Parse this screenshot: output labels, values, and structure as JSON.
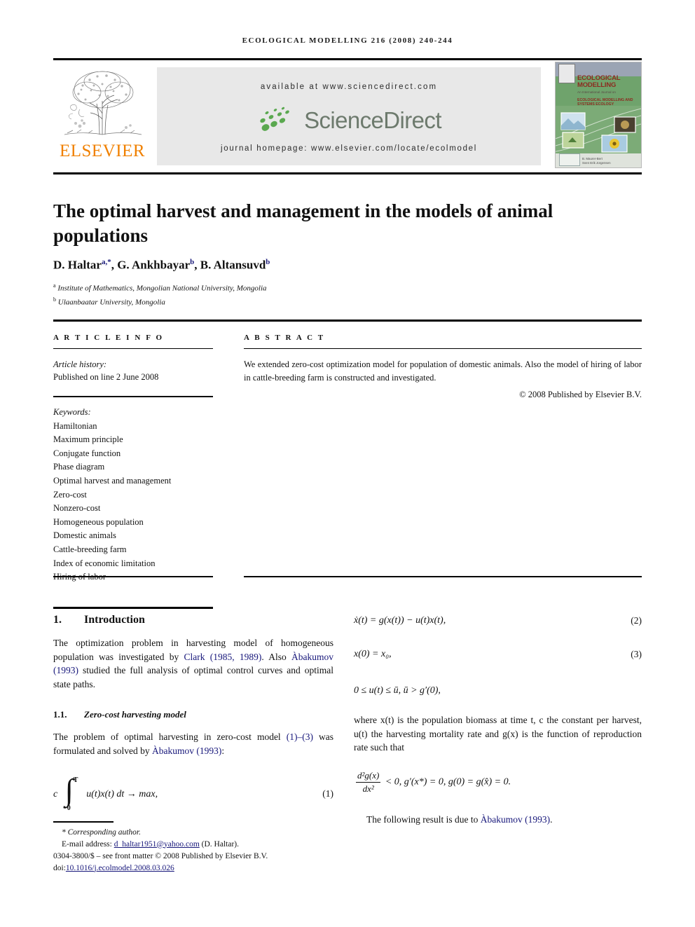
{
  "runhead": "ECOLOGICAL MODELLING 216 (2008) 240-244",
  "masthead": {
    "publisher_name": "ELSEVIER",
    "available_at": "available at www.sciencedirect.com",
    "sciencedirect_wordmark": "ScienceDirect",
    "journal_homepage": "journal homepage: www.elsevier.com/locate/ecolmodel",
    "cover": {
      "title_line1": "ECOLOGICAL",
      "title_line2": "MODELLING",
      "subtitle": "An International Journal on",
      "subtitle2_line1": "ECOLOGICAL MODELLING AND",
      "subtitle2_line2": "SYSTEMS ECOLOGY",
      "editor_line1": "B. Maurer-Bert",
      "editor_line2": "Sven Erik Jorgensen"
    }
  },
  "article": {
    "title": "The optimal harvest and management in the models of animal populations",
    "authors_html": "D. Haltar<sup>a,*</sup>, G. Ankhbayar<sup>b</sup>, B. Altansuvd<sup>b</sup>",
    "affiliation_a": "Institute of Mathematics, Mongolian National University, Mongolia",
    "affiliation_b": "Ulaanbaatar University, Mongolia"
  },
  "info": {
    "heading": "A R T I C L E   I N F O",
    "history_label": "Article history:",
    "history_value": "Published on line 2 June 2008",
    "keywords_label": "Keywords:",
    "keywords": [
      "Hamiltonian",
      "Maximum principle",
      "Conjugate function",
      "Phase diagram",
      "Optimal harvest and management",
      "Zero-cost",
      "Nonzero-cost",
      "Homogeneous population",
      "Domestic animals",
      "Cattle-breeding farm",
      "Index of economic limitation",
      "Hiring of labor"
    ]
  },
  "abstract": {
    "heading": "A B S T R A C T",
    "text": "We extended zero-cost optimization model for population of domestic animals. Also the model of hiring of labor in cattle-breeding farm is constructed and investigated.",
    "copyright": "© 2008 Published by Elsevier B.V."
  },
  "body": {
    "section1_num": "1.",
    "section1_title": "Introduction",
    "intro_p1_a": "The optimization problem in harvesting model of homogeneous population was investigated by ",
    "intro_cite1": "Clark (1985, 1989)",
    "intro_p1_b": ". Also ",
    "intro_cite2": "Àbakumov (1993)",
    "intro_p1_c": " studied the full analysis of optimal control curves and optimal state paths.",
    "sub11_num": "1.1.",
    "sub11_title": "Zero-cost harvesting model",
    "sub11_p_a": "The problem of optimal harvesting in zero-cost model ",
    "sub11_ref": "(1)–(3)",
    "sub11_p_b": " was formulated and solved by ",
    "sub11_cite": "Àbakumov (1993)",
    "sub11_p_c": ":",
    "eq1": {
      "lead": "c",
      "upper": "T",
      "lower": "0",
      "integrand": "u(t)x(t) dt → max,",
      "number": "(1)"
    },
    "eq2": {
      "text": "ẋ(t) = g(x(t)) − u(t)x(t),",
      "number": "(2)"
    },
    "eq3": {
      "text": "x(0) = x₀,",
      "number": "(3)"
    },
    "constraint": "0 ≤ u(t) ≤ ū, ū > g′(0),",
    "where_p": "where x(t) is the population biomass at time t, c the constant per harvest, u(t) the harvesting mortality rate and g(x) is the function of reproduction rate such that",
    "eq4": {
      "frac_num": "d²g(x)",
      "frac_den": "dx²",
      "rest": "< 0,    g′(x*) = 0,    g(0) = g(x̂) = 0."
    },
    "closing_a": "The following result is due to ",
    "closing_cite": "Àbakumov (1993)",
    "closing_b": "."
  },
  "footnote": {
    "corresponding": "* Corresponding author.",
    "email_label": "E-mail address: ",
    "email": "d_haltar1951@yahoo.com",
    "email_suffix": " (D. Haltar).",
    "issn_line": "0304-3800/$ – see front matter © 2008 Published by Elsevier B.V.",
    "doi_label": "doi:",
    "doi": "10.1016/j.ecolmodel.2008.03.026"
  },
  "colors": {
    "link": "#16167a",
    "elsevier_orange": "#F08000",
    "sciencedirect_green": "#5aa84f",
    "sciencedirect_gray": "#6d7a6d"
  }
}
